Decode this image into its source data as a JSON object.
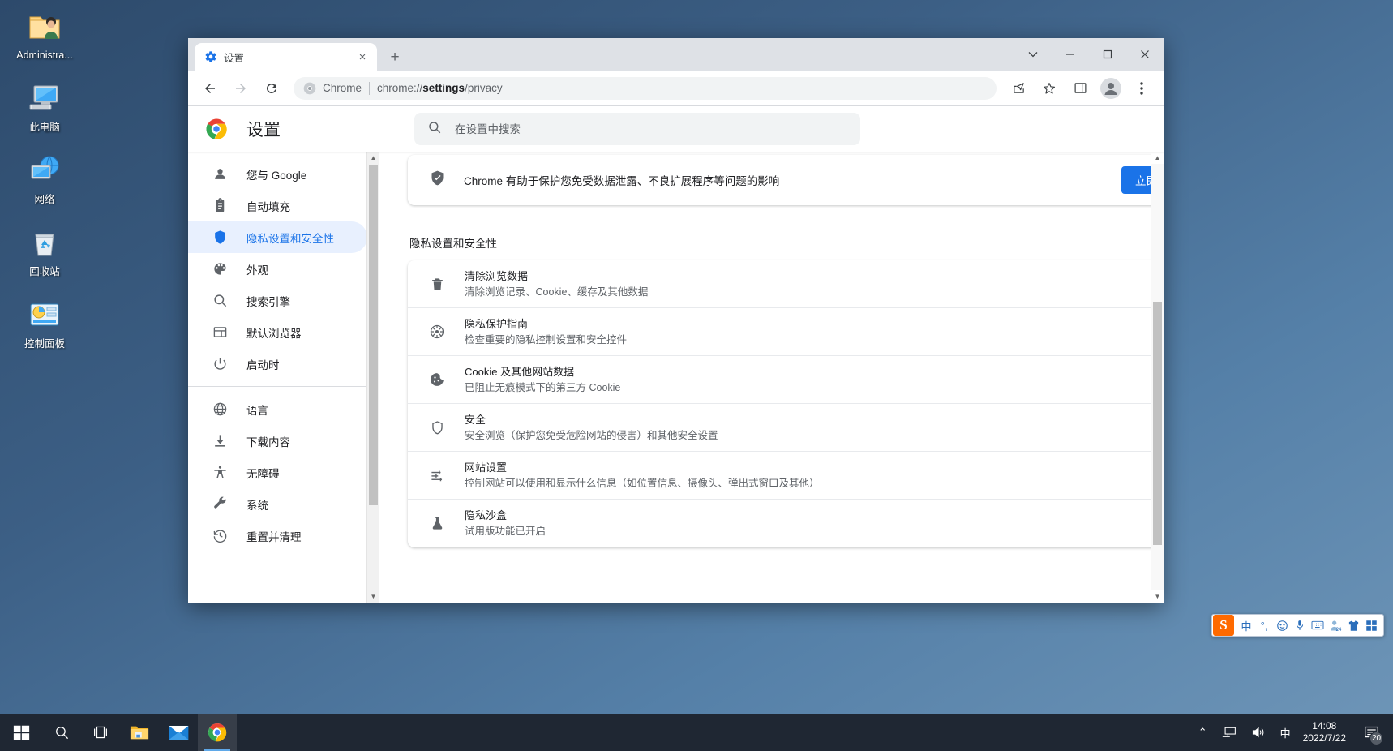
{
  "desktop": {
    "icons": [
      {
        "label": "Administra...",
        "icon": "user-folder-icon"
      },
      {
        "label": "此电脑",
        "icon": "computer-icon"
      },
      {
        "label": "网络",
        "icon": "network-icon"
      },
      {
        "label": "回收站",
        "icon": "recycle-bin-icon"
      },
      {
        "label": "控制面板",
        "icon": "control-panel-icon"
      }
    ]
  },
  "browser": {
    "tab": {
      "title": "设置",
      "favicon": "gear-icon",
      "close": "×"
    },
    "new_tab": "+",
    "window_controls": {
      "minimize": "–",
      "maximize": "□",
      "close": "✕",
      "chevron": "⌄"
    },
    "toolbar": {
      "back": "←",
      "forward": "→",
      "reload": "⟳",
      "scheme_label": "Chrome",
      "url_prefix": "chrome://",
      "url_bold": "settings",
      "url_suffix": "/privacy",
      "share": "share-icon",
      "bookmark": "star-icon",
      "sidepanel": "side-panel-icon",
      "profile": "profile-icon",
      "menu": "⋮"
    }
  },
  "settings": {
    "title": "设置",
    "search": {
      "placeholder": "在设置中搜索",
      "value": ""
    },
    "nav_group_1": [
      {
        "label": "您与 Google",
        "icon": "person-icon"
      },
      {
        "label": "自动填充",
        "icon": "clipboard-icon"
      },
      {
        "label": "隐私设置和安全性",
        "icon": "shield-icon",
        "active": true
      },
      {
        "label": "外观",
        "icon": "palette-icon"
      },
      {
        "label": "搜索引擎",
        "icon": "search-icon"
      },
      {
        "label": "默认浏览器",
        "icon": "browser-window-icon"
      },
      {
        "label": "启动时",
        "icon": "power-icon"
      }
    ],
    "nav_group_2": [
      {
        "label": "语言",
        "icon": "globe-icon"
      },
      {
        "label": "下载内容",
        "icon": "download-icon"
      },
      {
        "label": "无障碍",
        "icon": "accessibility-icon"
      },
      {
        "label": "系统",
        "icon": "wrench-icon"
      },
      {
        "label": "重置并清理",
        "icon": "history-icon"
      }
    ],
    "safety_check": {
      "text": "Chrome 有助于保护您免受数据泄露、不良扩展程序等问题的影响",
      "button": "立即检查",
      "button_color": "#1a73e8",
      "icon": "shield-check-icon"
    },
    "section_title": "隐私设置和安全性",
    "rows": [
      {
        "icon": "trash-icon",
        "title": "清除浏览数据",
        "subtitle": "清除浏览记录、Cookie、缓存及其他数据",
        "action": "chevron-right-icon"
      },
      {
        "icon": "privacy-guide-icon",
        "title": "隐私保护指南",
        "subtitle": "检查重要的隐私控制设置和安全控件",
        "action": "chevron-right-icon"
      },
      {
        "icon": "cookie-icon",
        "title": "Cookie 及其他网站数据",
        "subtitle": "已阻止无痕模式下的第三方 Cookie",
        "action": "chevron-right-icon"
      },
      {
        "icon": "shield-icon",
        "title": "安全",
        "subtitle": "安全浏览（保护您免受危险网站的侵害）和其他安全设置",
        "action": "chevron-right-icon"
      },
      {
        "icon": "sliders-icon",
        "title": "网站设置",
        "subtitle": "控制网站可以使用和显示什么信息（如位置信息、摄像头、弹出式窗口及其他）",
        "action": "chevron-right-icon"
      },
      {
        "icon": "flask-icon",
        "title": "隐私沙盒",
        "subtitle": "试用版功能已开启",
        "action": "external-link-icon"
      }
    ]
  },
  "ime": {
    "logo": "S",
    "items": [
      "中",
      "°,",
      "☺",
      "mic-icon",
      "keyboard-icon",
      "user-icon",
      "shirt-icon",
      "apps-icon"
    ]
  },
  "taskbar": {
    "start": "windows-logo-icon",
    "search": "search-icon",
    "task_view": "task-view-icon",
    "apps": [
      "file-explorer-icon",
      "mail-icon",
      "chrome-icon"
    ],
    "tray": {
      "chevron": "⌃",
      "network": "network-tray-icon",
      "volume": "volume-icon",
      "ime": "中",
      "time": "14:08",
      "date": "2022/7/22",
      "notifications": "20"
    }
  }
}
